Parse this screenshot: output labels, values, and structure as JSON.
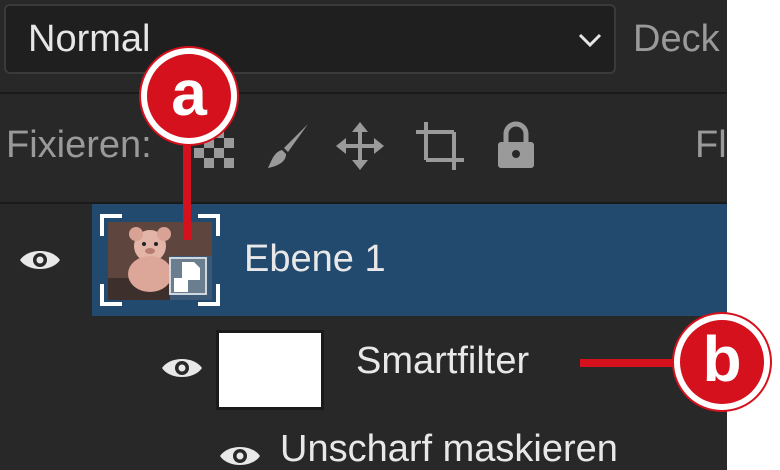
{
  "blend_mode": {
    "value": "Normal"
  },
  "opacity": {
    "label": "Deck"
  },
  "lock": {
    "label": "Fixieren:",
    "fill_label": "Fl"
  },
  "icons": [
    "transparency-lock-icon",
    "brush-icon",
    "move-icon",
    "artboard-icon",
    "lock-icon",
    "eye-icon",
    "smart-object-icon",
    "chevron-down-icon"
  ],
  "layers": [
    {
      "name": "Ebene 1",
      "selected": true,
      "type": "smart-object"
    }
  ],
  "smart_filters": {
    "label": "Smartfilter",
    "filters": [
      {
        "name": "Unscharf maskieren"
      }
    ]
  },
  "callouts": {
    "a": "a",
    "b": "b"
  },
  "colors": {
    "panel": "#282828",
    "selected": "#214a6e",
    "callout": "#d4111c"
  }
}
